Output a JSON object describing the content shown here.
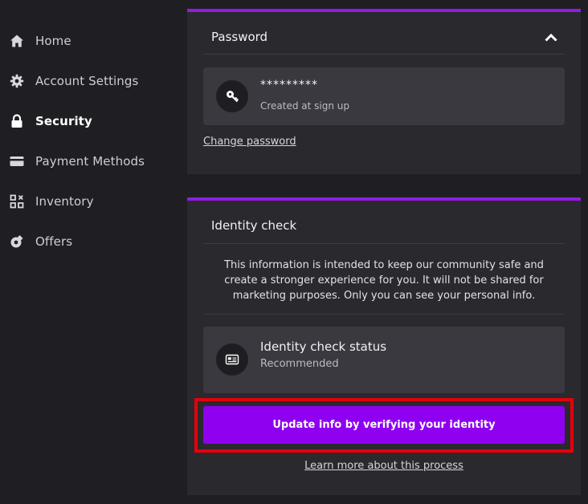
{
  "sidebar": {
    "items": [
      {
        "label": "Home",
        "icon": "home-icon"
      },
      {
        "label": "Account Settings",
        "icon": "gear-icon"
      },
      {
        "label": "Security",
        "icon": "lock-icon",
        "active": true
      },
      {
        "label": "Payment Methods",
        "icon": "credit-card-icon"
      },
      {
        "label": "Inventory",
        "icon": "inventory-icon"
      },
      {
        "label": "Offers",
        "icon": "offers-icon"
      }
    ]
  },
  "password": {
    "title": "Password",
    "masked_value": "*********",
    "subtitle": "Created at sign up",
    "change_link": "Change password"
  },
  "identity": {
    "title": "Identity check",
    "info": "This information is intended to keep our community safe and create a stronger experience for you. It will not be shared for marketing purposes. Only you can see your personal info.",
    "status_title": "Identity check status",
    "status_value": "Recommended",
    "verify_button": "Update info by verifying your identity",
    "learn_more_link": "Learn more about this process"
  },
  "colors": {
    "accent": "#8f00f0",
    "card_border": "#8f1de6",
    "highlight": "#e3020b",
    "background": "#1f1e22",
    "card": "#2a292e"
  }
}
